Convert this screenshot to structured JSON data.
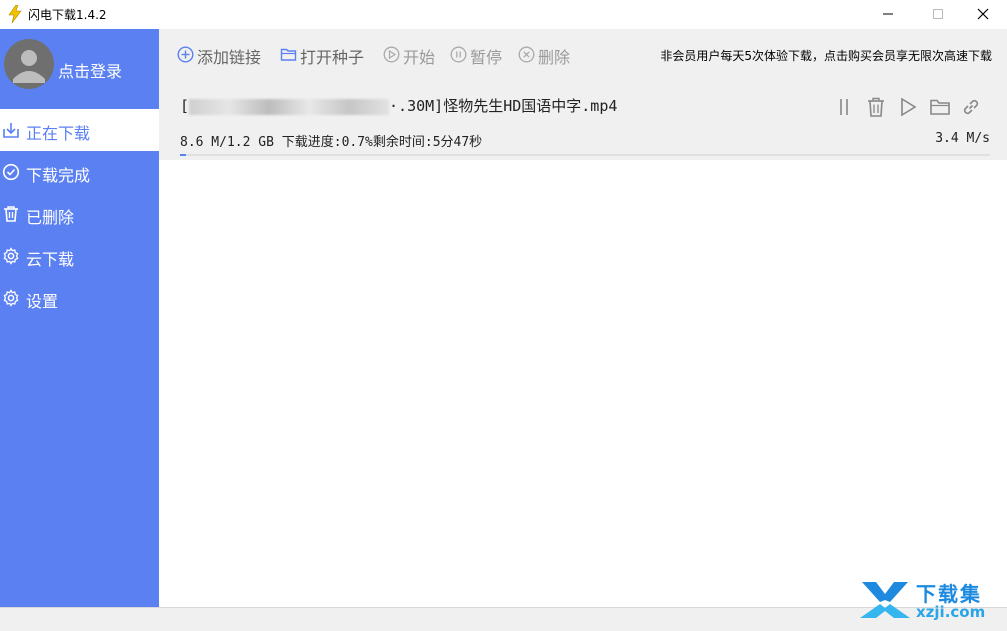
{
  "window": {
    "title": "闪电下载1.4.2",
    "accent_color": "#5b80f2"
  },
  "sidebar": {
    "login_label": "点击登录",
    "items": [
      {
        "label": "正在下载",
        "icon": "download-icon",
        "active": true
      },
      {
        "label": "下载完成",
        "icon": "check-circle-icon",
        "active": false
      },
      {
        "label": "已删除",
        "icon": "trash-icon",
        "active": false
      },
      {
        "label": "云下载",
        "icon": "gear-icon",
        "active": false
      },
      {
        "label": "设置",
        "icon": "gear-icon",
        "active": false
      }
    ]
  },
  "toolbar": {
    "add_link": "添加链接",
    "open_torrent": "打开种子",
    "start": "开始",
    "pause": "暂停",
    "delete": "删除",
    "notice": "非会员用户每天5次体验下载，点击购买会员享无限次高速下载"
  },
  "task": {
    "name_prefix": "[",
    "name_partial": "·.30M]",
    "name_suffix": "怪物先生HD国语中字.mp4",
    "stats": "8.6 M/1.2 GB 下载进度:0.7%剩余时间:5分47秒",
    "speed": "3.4 M/s",
    "progress": 0.007
  },
  "watermark": {
    "line1": "下载集",
    "line2": "xzji.com"
  }
}
